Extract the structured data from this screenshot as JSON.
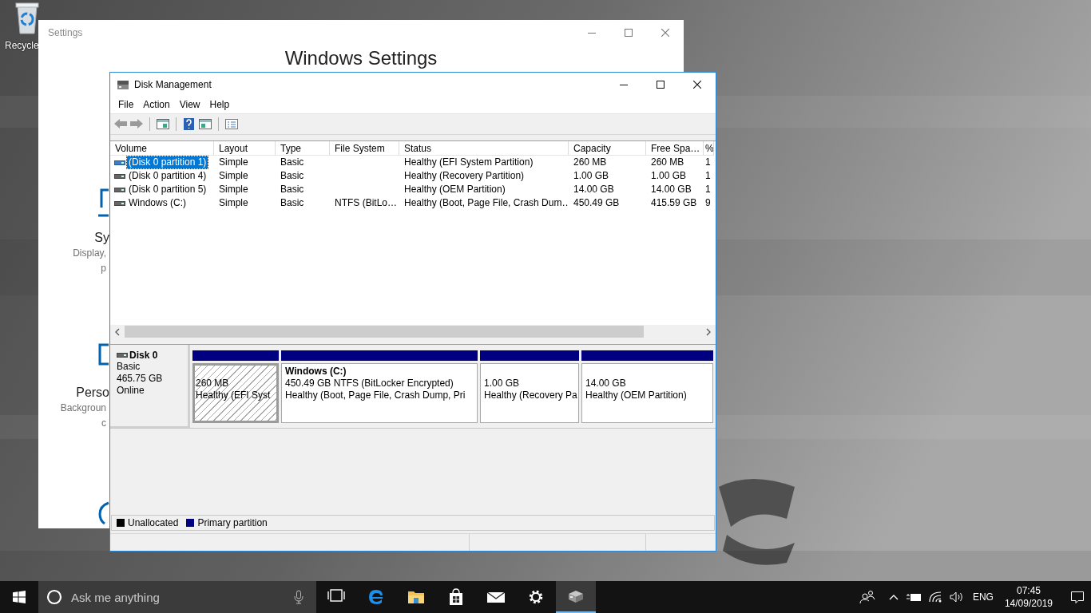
{
  "desktop": {
    "icons": [
      {
        "label": "Recycle"
      }
    ]
  },
  "settings_window": {
    "title": "Settings",
    "heading": "Windows Settings",
    "items": [
      {
        "title": "Sy",
        "description": [
          "Display,",
          "p"
        ]
      },
      {
        "title": "Perso",
        "description": [
          "Backgroun",
          "c"
        ]
      }
    ]
  },
  "disk_management": {
    "title": "Disk Management",
    "menu": [
      "File",
      "Action",
      "View",
      "Help"
    ],
    "table": {
      "columns": [
        "Volume",
        "Layout",
        "Type",
        "File System",
        "Status",
        "Capacity",
        "Free Spa…",
        "%"
      ],
      "rows": [
        {
          "selected": true,
          "cells": [
            "(Disk 0 partition 1)",
            "Simple",
            "Basic",
            "",
            "Healthy (EFI System Partition)",
            "260 MB",
            "260 MB",
            "1"
          ]
        },
        {
          "selected": false,
          "cells": [
            "(Disk 0 partition 4)",
            "Simple",
            "Basic",
            "",
            "Healthy (Recovery Partition)",
            "1.00 GB",
            "1.00 GB",
            "1"
          ]
        },
        {
          "selected": false,
          "cells": [
            "(Disk 0 partition 5)",
            "Simple",
            "Basic",
            "",
            "Healthy (OEM Partition)",
            "14.00 GB",
            "14.00 GB",
            "1"
          ]
        },
        {
          "selected": false,
          "cells": [
            "Windows (C:)",
            "Simple",
            "Basic",
            "NTFS (BitLo…",
            "Healthy (Boot, Page File, Crash Dum…",
            "450.49 GB",
            "415.59 GB",
            "9"
          ]
        }
      ]
    },
    "disks": [
      {
        "name": "Disk 0",
        "type": "Basic",
        "size": "465.75 GB",
        "status": "Online",
        "partitions": [
          {
            "selected": true,
            "size": "260 MB",
            "status": "Healthy (EFI Syst"
          },
          {
            "selected": false,
            "name": "Windows  (C:)",
            "size": "450.49 GB NTFS (BitLocker Encrypted)",
            "status": "Healthy (Boot, Page File, Crash Dump, Pri"
          },
          {
            "selected": false,
            "size": "1.00 GB",
            "status": "Healthy (Recovery Pa"
          },
          {
            "selected": false,
            "size": "14.00 GB",
            "status": "Healthy (OEM Partition)"
          }
        ]
      }
    ],
    "legend": [
      {
        "label": "Unallocated",
        "color": "#000000"
      },
      {
        "label": "Primary partition",
        "color": "#000080"
      }
    ]
  },
  "taskbar": {
    "search": {
      "placeholder": "Ask me anything"
    },
    "apps": [
      {
        "kind": "task-view",
        "active": false
      },
      {
        "kind": "edge",
        "active": false
      },
      {
        "kind": "explorer",
        "active": false
      },
      {
        "kind": "store",
        "active": false
      },
      {
        "kind": "mail",
        "active": false
      },
      {
        "kind": "settings",
        "active": false
      },
      {
        "kind": "disk",
        "active": true
      }
    ],
    "tray": {
      "language": "ENG",
      "time": "07:45",
      "date": "14/09/2019"
    }
  }
}
